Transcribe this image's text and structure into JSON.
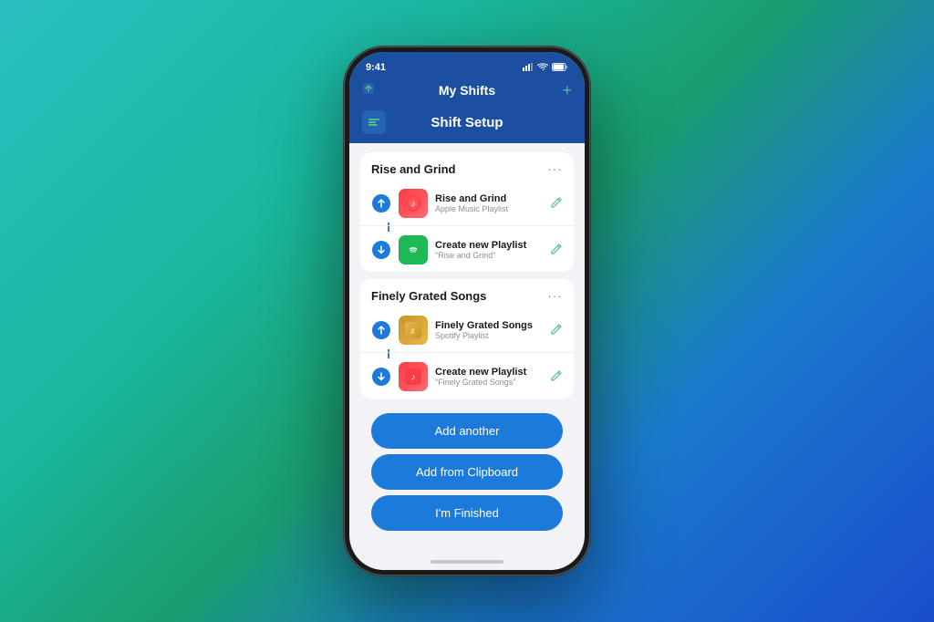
{
  "statusBar": {
    "time": "9:41",
    "signal": "●●●",
    "wifi": "wifi",
    "battery": "battery"
  },
  "navBar": {
    "parentTitle": "My Shifts",
    "addIcon": "+"
  },
  "header": {
    "title": "Shift Setup",
    "appIcon": "⚙"
  },
  "sections": [
    {
      "id": "rise-and-grind",
      "title": "Rise and Grind",
      "menuLabel": "...",
      "shortcuts": [
        {
          "connectorType": "shortcut",
          "appType": "apple-music",
          "name": "Rise and Grind",
          "sub": "Apple Music Playlist",
          "editLabel": "✎"
        },
        {
          "connectorType": "down",
          "appType": "spotify",
          "name": "Create new Playlist",
          "sub": "\"Rise and Grind\"",
          "editLabel": "✎"
        }
      ]
    },
    {
      "id": "finely-grated",
      "title": "Finely Grated Songs",
      "menuLabel": "...",
      "shortcuts": [
        {
          "connectorType": "shortcut",
          "appType": "gold",
          "name": "Finely Grated Songs",
          "sub": "Spotify Playlist",
          "editLabel": "✎"
        },
        {
          "connectorType": "down",
          "appType": "apple-music-red",
          "name": "Create new Playlist",
          "sub": "\"Finely Grated Songs\"",
          "editLabel": "✎"
        }
      ]
    }
  ],
  "buttons": {
    "addAnother": "Add another",
    "addFromClipboard": "Add from Clipboard",
    "imFinished": "I'm Finished"
  }
}
